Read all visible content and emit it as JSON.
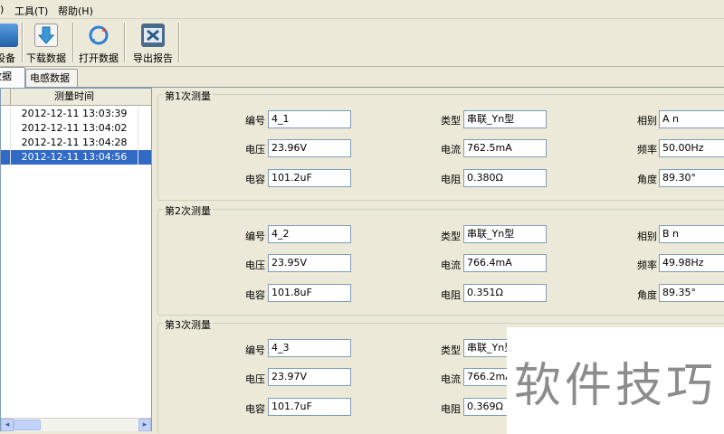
{
  "menu": {
    "items": [
      ")",
      "工具(T)",
      "帮助(H)"
    ]
  },
  "toolbar": {
    "buttons": [
      "设备",
      "下载数据",
      "打开数据",
      "导出报告"
    ]
  },
  "tabs": [
    "数据",
    "电感数据"
  ],
  "list": {
    "header": "测量时间",
    "rows": [
      "2012-12-11 13:03:39",
      "2012-12-11 13:04:02",
      "2012-12-11 13:04:28",
      "2012-12-11 13:04:56"
    ],
    "selected_index": 3
  },
  "labels": {
    "number": "编号",
    "type": "类型",
    "phase": "相别",
    "voltage": "电压",
    "current": "电流",
    "frequency": "频率",
    "capacitance": "电容",
    "resistance": "电阻",
    "angle": "角度"
  },
  "measurements": [
    {
      "title": "第1次测量",
      "number": "4_1",
      "type": "串联_Yn型",
      "phase": "A n",
      "voltage": "23.96V",
      "current": "762.5mA",
      "frequency": "50.00Hz",
      "capacitance": "101.2uF",
      "resistance": "0.380Ω",
      "angle": "89.30°"
    },
    {
      "title": "第2次测量",
      "number": "4_2",
      "type": "串联_Yn型",
      "phase": "B n",
      "voltage": "23.95V",
      "current": "766.4mA",
      "frequency": "49.98Hz",
      "capacitance": "101.8uF",
      "resistance": "0.351Ω",
      "angle": "89.35°"
    },
    {
      "title": "第3次测量",
      "number": "4_3",
      "type": "串联_Yn型",
      "phase": "",
      "voltage": "23.97V",
      "current": "766.2mA",
      "frequency": "",
      "capacitance": "101.7uF",
      "resistance": "0.369Ω",
      "angle": ""
    }
  ],
  "watermark": "软件技巧",
  "colors": {
    "selection": "#316ac5",
    "window_bg": "#ece9d8"
  }
}
